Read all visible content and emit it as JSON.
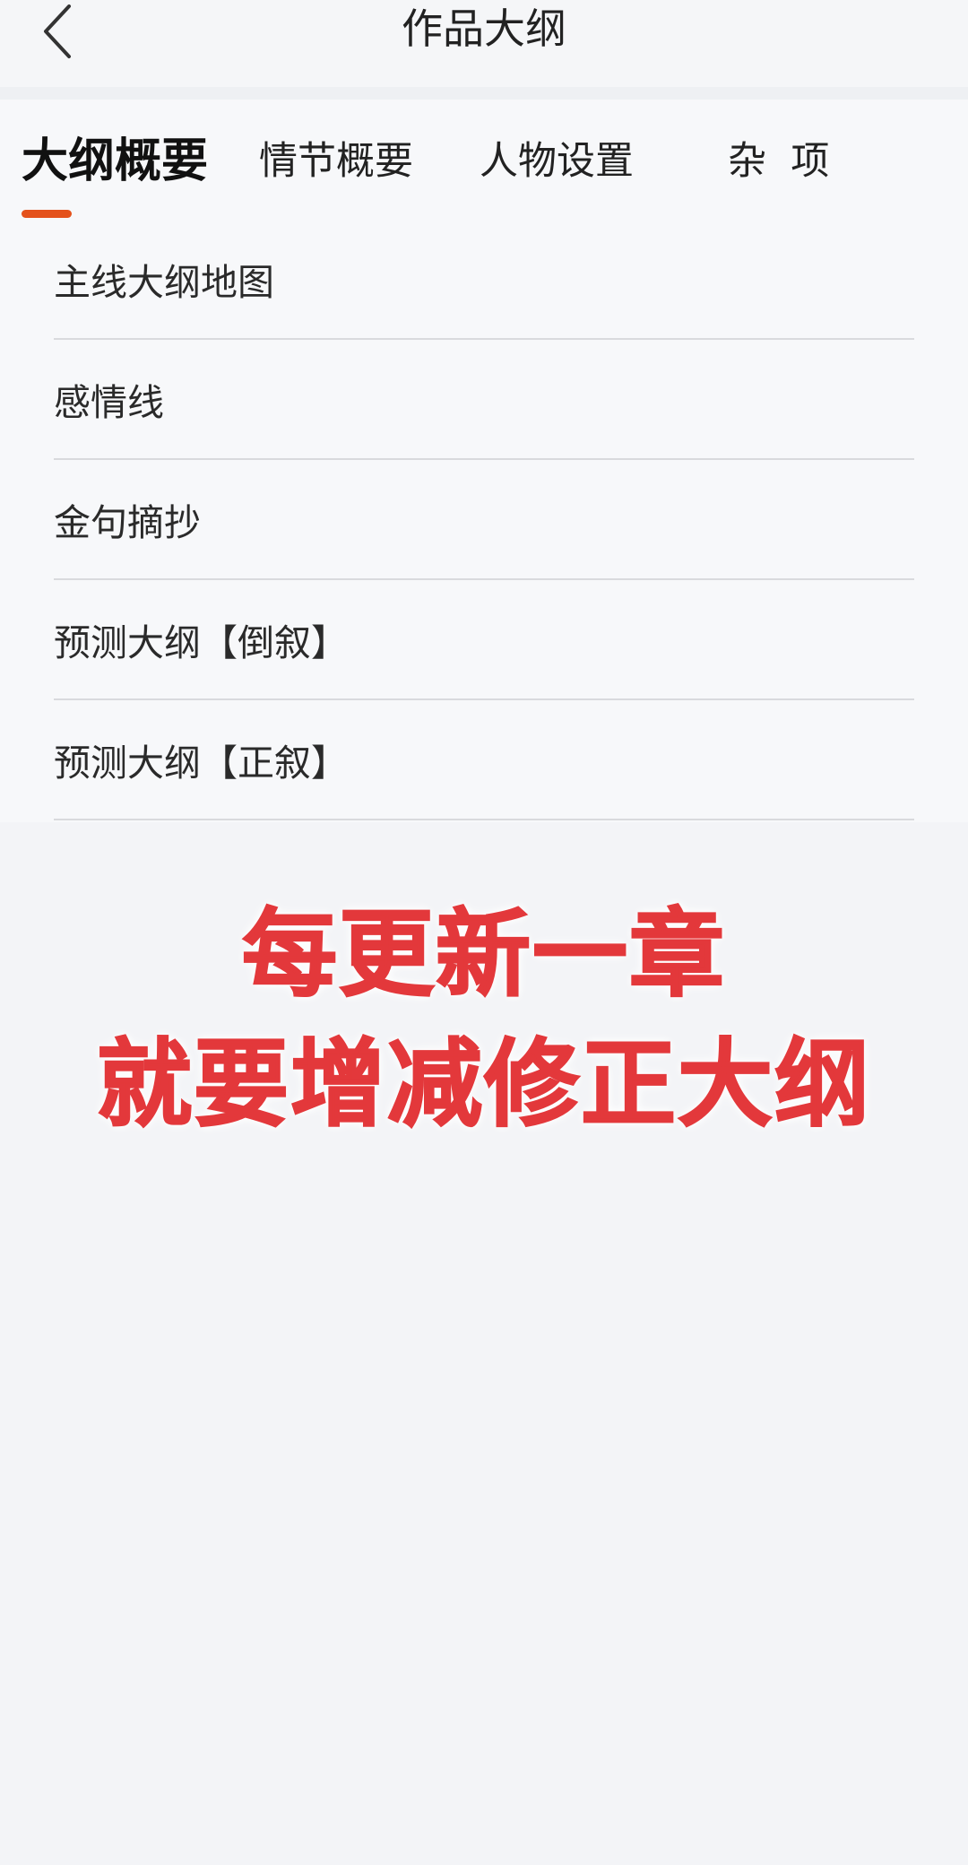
{
  "header": {
    "title": "作品大纲",
    "back_icon": "chevron-left-icon"
  },
  "tabs": [
    {
      "label": "大纲概要",
      "active": true
    },
    {
      "label": "情节概要",
      "active": false
    },
    {
      "label": "人物设置",
      "active": false
    },
    {
      "label": "杂  项",
      "active": false
    }
  ],
  "list": {
    "items": [
      {
        "label": "主线大纲地图"
      },
      {
        "label": "感情线"
      },
      {
        "label": "金句摘抄"
      },
      {
        "label": "预测大纲【倒叙】"
      },
      {
        "label": "预测大纲【正叙】"
      }
    ]
  },
  "caption": {
    "line1": "每更新一章",
    "line2": "就要增减修正大纲"
  },
  "colors": {
    "accent": "#e4521c",
    "caption_red": "#e3383b"
  }
}
